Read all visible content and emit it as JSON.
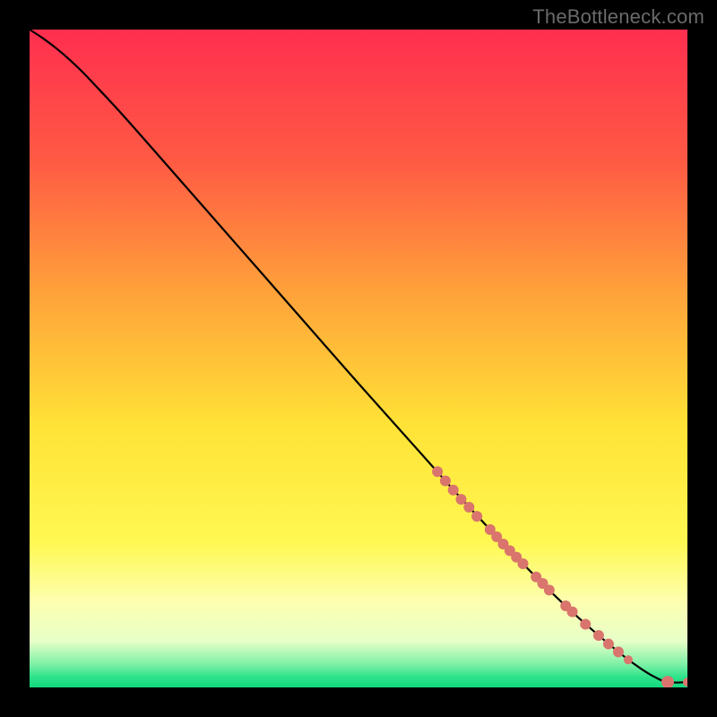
{
  "watermark": "TheBottleneck.com",
  "chart_data": {
    "type": "line",
    "title": "",
    "xlabel": "",
    "ylabel": "",
    "xlim": [
      0,
      100
    ],
    "ylim": [
      0,
      100
    ],
    "grid": false,
    "legend": false,
    "background_gradient_stops": [
      {
        "offset": 0.0,
        "color": "#ff2e4f"
      },
      {
        "offset": 0.2,
        "color": "#ff5a44"
      },
      {
        "offset": 0.4,
        "color": "#ffa23a"
      },
      {
        "offset": 0.6,
        "color": "#ffe236"
      },
      {
        "offset": 0.78,
        "color": "#fff852"
      },
      {
        "offset": 0.87,
        "color": "#fdffb0"
      },
      {
        "offset": 0.93,
        "color": "#e7ffc8"
      },
      {
        "offset": 0.965,
        "color": "#7df0a6"
      },
      {
        "offset": 0.985,
        "color": "#2be38a"
      },
      {
        "offset": 1.0,
        "color": "#14d87f"
      }
    ],
    "series": [
      {
        "name": "bottleneck-curve",
        "color": "#000000",
        "x": [
          0.0,
          2.0,
          4.0,
          6.0,
          8.0,
          10.0,
          14.0,
          20.0,
          30.0,
          40.0,
          50.0,
          60.0,
          65.0,
          70.0,
          75.0,
          80.0,
          85.0,
          90.0,
          93.0,
          95.0,
          97.0,
          100.0
        ],
        "y": [
          100.0,
          98.7,
          97.2,
          95.5,
          93.6,
          91.5,
          87.2,
          80.4,
          69.0,
          57.6,
          46.2,
          35.0,
          29.4,
          24.0,
          18.8,
          13.8,
          9.2,
          5.0,
          2.8,
          1.6,
          0.8,
          0.8
        ]
      }
    ],
    "markers": {
      "name": "highlighted-points",
      "color": "#d9756d",
      "points": [
        {
          "x": 62.0,
          "y": 32.8,
          "r": 6
        },
        {
          "x": 63.2,
          "y": 31.4,
          "r": 6
        },
        {
          "x": 64.4,
          "y": 30.0,
          "r": 6
        },
        {
          "x": 65.6,
          "y": 28.6,
          "r": 6
        },
        {
          "x": 66.8,
          "y": 27.4,
          "r": 6
        },
        {
          "x": 68.0,
          "y": 26.0,
          "r": 6
        },
        {
          "x": 70.0,
          "y": 24.0,
          "r": 6
        },
        {
          "x": 71.0,
          "y": 22.9,
          "r": 6
        },
        {
          "x": 72.0,
          "y": 21.8,
          "r": 6
        },
        {
          "x": 73.0,
          "y": 20.8,
          "r": 6
        },
        {
          "x": 74.0,
          "y": 19.8,
          "r": 6
        },
        {
          "x": 75.0,
          "y": 18.8,
          "r": 6
        },
        {
          "x": 77.0,
          "y": 16.8,
          "r": 6
        },
        {
          "x": 78.0,
          "y": 15.8,
          "r": 6
        },
        {
          "x": 79.0,
          "y": 14.8,
          "r": 6
        },
        {
          "x": 81.5,
          "y": 12.4,
          "r": 6
        },
        {
          "x": 82.5,
          "y": 11.5,
          "r": 6
        },
        {
          "x": 84.5,
          "y": 9.6,
          "r": 6
        },
        {
          "x": 86.5,
          "y": 7.9,
          "r": 6
        },
        {
          "x": 88.0,
          "y": 6.6,
          "r": 6
        },
        {
          "x": 89.5,
          "y": 5.4,
          "r": 6
        },
        {
          "x": 91.0,
          "y": 4.2,
          "r": 5
        },
        {
          "x": 97.0,
          "y": 0.8,
          "r": 7
        },
        {
          "x": 100.0,
          "y": 0.8,
          "r": 5
        }
      ]
    }
  }
}
